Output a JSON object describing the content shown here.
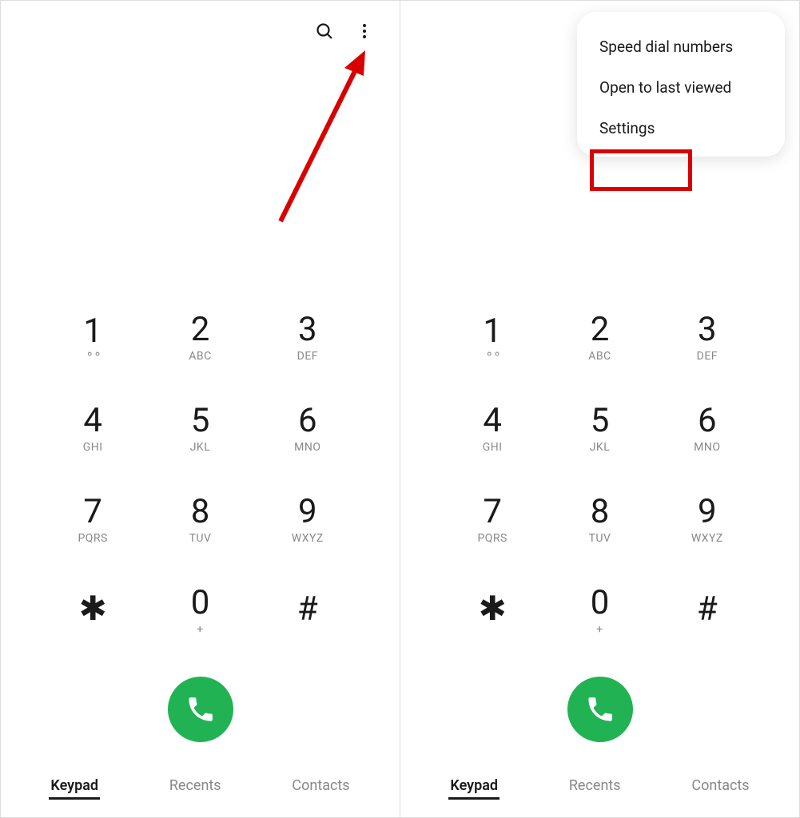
{
  "toolbar": {
    "search_icon": "search",
    "more_icon": "more"
  },
  "menu": {
    "items": [
      "Speed dial numbers",
      "Open to last viewed",
      "Settings"
    ],
    "highlighted": "Settings"
  },
  "keypad": {
    "keys": [
      {
        "digit": "1",
        "sub": "voicemail"
      },
      {
        "digit": "2",
        "sub": "ABC"
      },
      {
        "digit": "3",
        "sub": "DEF"
      },
      {
        "digit": "4",
        "sub": "GHI"
      },
      {
        "digit": "5",
        "sub": "JKL"
      },
      {
        "digit": "6",
        "sub": "MNO"
      },
      {
        "digit": "7",
        "sub": "PQRS"
      },
      {
        "digit": "8",
        "sub": "TUV"
      },
      {
        "digit": "9",
        "sub": "WXYZ"
      },
      {
        "digit": "✱",
        "sub": ""
      },
      {
        "digit": "0",
        "sub": "+"
      },
      {
        "digit": "#",
        "sub": ""
      }
    ]
  },
  "tabs": {
    "keypad": "Keypad",
    "recents": "Recents",
    "contacts": "Contacts"
  },
  "colors": {
    "call_button": "#21b353",
    "highlight": "#d90000",
    "arrow": "#d90000"
  }
}
